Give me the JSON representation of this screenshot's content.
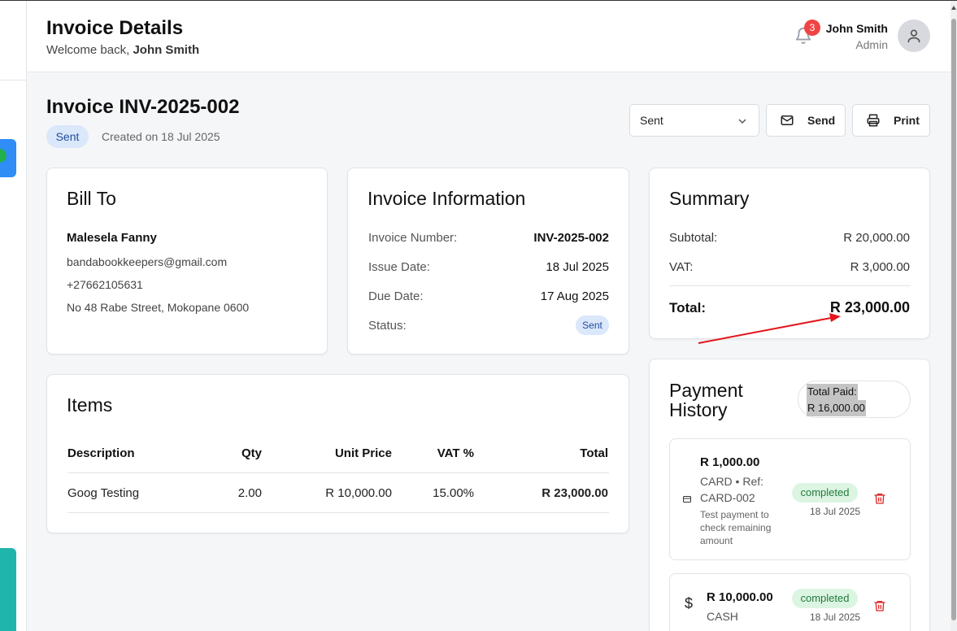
{
  "header": {
    "title": "Invoice Details",
    "welcome_prefix": "Welcome back,",
    "welcome_name": "John Smith",
    "notification_count": "3",
    "user_name": "John Smith",
    "user_role": "Admin"
  },
  "invoice": {
    "title": "Invoice INV-2025-002",
    "status": "Sent",
    "created": "Created on 18 Jul 2025"
  },
  "actions": {
    "status_select_value": "Sent",
    "send_label": "Send",
    "print_label": "Print"
  },
  "bill_to": {
    "heading": "Bill To",
    "name": "Malesela Fanny",
    "email": "bandabookkeepers@gmail.com",
    "phone": "+27662105631",
    "address": "No 48 Rabe Street, Mokopane 0600"
  },
  "invoice_info": {
    "heading": "Invoice Information",
    "rows": [
      {
        "label": "Invoice Number:",
        "value": "INV-2025-002"
      },
      {
        "label": "Issue Date:",
        "value": "18 Jul 2025"
      },
      {
        "label": "Due Date:",
        "value": "17 Aug 2025"
      },
      {
        "label": "Status:",
        "value": "Sent"
      }
    ]
  },
  "summary": {
    "heading": "Summary",
    "subtotal_label": "Subtotal:",
    "subtotal_value": "R 20,000.00",
    "vat_label": "VAT:",
    "vat_value": "R 3,000.00",
    "total_label": "Total:",
    "total_value": "R 23,000.00"
  },
  "items": {
    "heading": "Items",
    "columns": [
      "Description",
      "Qty",
      "Unit Price",
      "VAT %",
      "Total"
    ],
    "rows": [
      [
        "Goog Testing",
        "2.00",
        "R 10,000.00",
        "15.00%",
        "R 23,000.00"
      ]
    ]
  },
  "payment_history": {
    "heading": "Payment History",
    "total_paid_label": "Total Paid:",
    "total_paid_value": "R 16,000.00",
    "payments": [
      {
        "amount": "R 1,000.00",
        "method": "CARD • Ref: CARD-002",
        "note": "Test payment to check remaining amount",
        "status": "completed",
        "date": "18 Jul 2025",
        "icon": "credit-card-icon"
      },
      {
        "amount": "R 10,000.00",
        "method": "CASH",
        "status": "completed",
        "date": "18 Jul 2025",
        "icon": "dollar-icon"
      }
    ]
  },
  "colors": {
    "accent_blue": "#2f8df5",
    "teal": "#1fb5ad",
    "badge_red": "#ef4444",
    "annotation_arrow": "#e3161b"
  }
}
